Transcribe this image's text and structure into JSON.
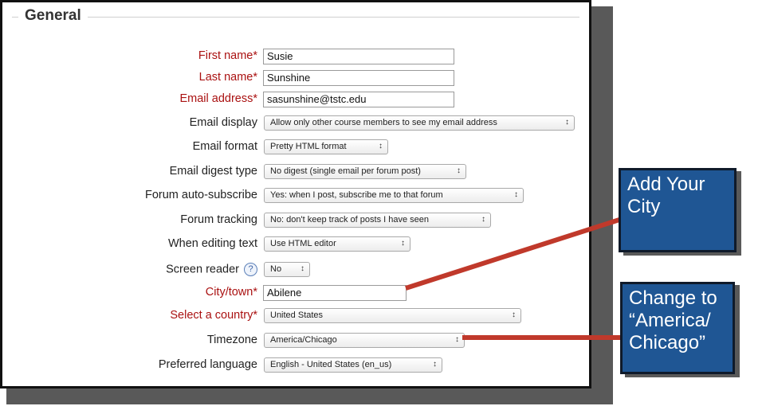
{
  "form": {
    "legend": "General",
    "first_name": {
      "label": "First name*",
      "value": "Susie"
    },
    "last_name": {
      "label": "Last name*",
      "value": "Sunshine"
    },
    "email_address": {
      "label": "Email address*",
      "value": "sasunshine@tstc.edu"
    },
    "email_display": {
      "label": "Email display",
      "value": "Allow only other course members to see my email address"
    },
    "email_format": {
      "label": "Email format",
      "value": "Pretty HTML format"
    },
    "email_digest": {
      "label": "Email digest type",
      "value": "No digest (single email per forum post)"
    },
    "forum_auto_subscribe": {
      "label": "Forum auto-subscribe",
      "value": "Yes: when I post, subscribe me to that forum"
    },
    "forum_tracking": {
      "label": "Forum tracking",
      "value": "No: don't keep track of posts I have seen"
    },
    "editing_text": {
      "label": "When editing text",
      "value": "Use HTML editor"
    },
    "screen_reader": {
      "label": "Screen reader",
      "value": "No",
      "help": "?"
    },
    "city": {
      "label": "City/town*",
      "value": "Abilene"
    },
    "country": {
      "label": "Select a country*",
      "value": "United States"
    },
    "timezone": {
      "label": "Timezone",
      "value": "America/Chicago"
    },
    "language": {
      "label": "Preferred language",
      "value": "English ‐ United States (en_us)"
    },
    "select_arrow": "↕"
  },
  "callouts": {
    "city": {
      "line1": "Add Your",
      "line2": "City"
    },
    "timezone": {
      "line1": "Change to",
      "line2": "“America/",
      "line3": "Chicago”"
    }
  },
  "colors": {
    "required_label": "#aa1111",
    "callout_fill": "#1f5694",
    "connector": "#c0392b"
  }
}
